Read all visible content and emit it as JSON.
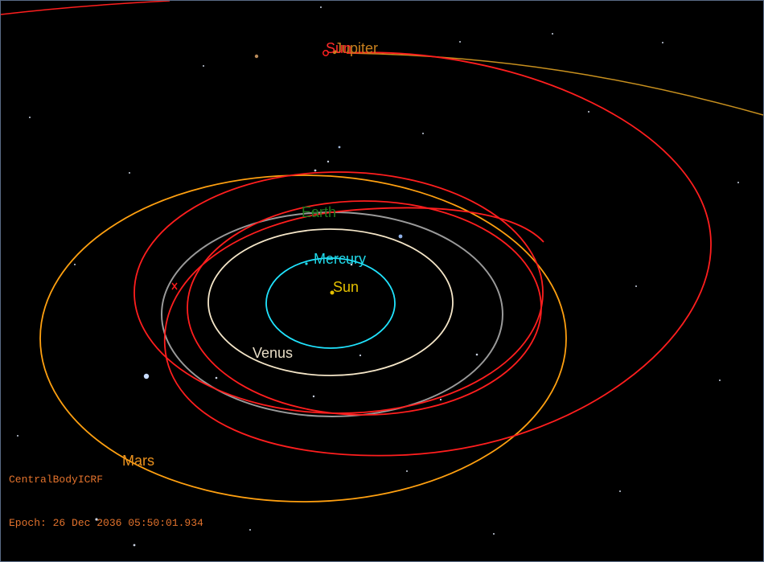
{
  "colors": {
    "background": "#000000",
    "hud_text": "#e2722c",
    "trajectory": "#ff1e1e",
    "mercury_orbit": "#20e4ff",
    "venus_orbit": "#f5e6c8",
    "earth_orbit": "#9a9a9a",
    "mars_orbit": "#ffa010",
    "jupiter_orbit": "#c8901e"
  },
  "bodies": {
    "sun": {
      "label": "Sun",
      "color": "#e4c000",
      "icon": "sun-icon"
    },
    "mercury": {
      "label": "Mercury",
      "color": "#20d8e8"
    },
    "venus": {
      "label": "Venus",
      "color": "#e8ddc6"
    },
    "earth": {
      "label": "Earth",
      "color": "#1e7a1e"
    },
    "mars": {
      "label": "Mars",
      "color": "#e8901e"
    },
    "jupiter": {
      "label": "Jupiter",
      "color": "#c8801e"
    },
    "spacecraft": {
      "label": "Sun",
      "color": "#ff2a2a",
      "icon": "spacecraft-icon"
    }
  },
  "hud": {
    "central_body": "CentralBodyICRF",
    "epoch": "Epoch: 26 Dec 2036 05:50:01.934"
  }
}
